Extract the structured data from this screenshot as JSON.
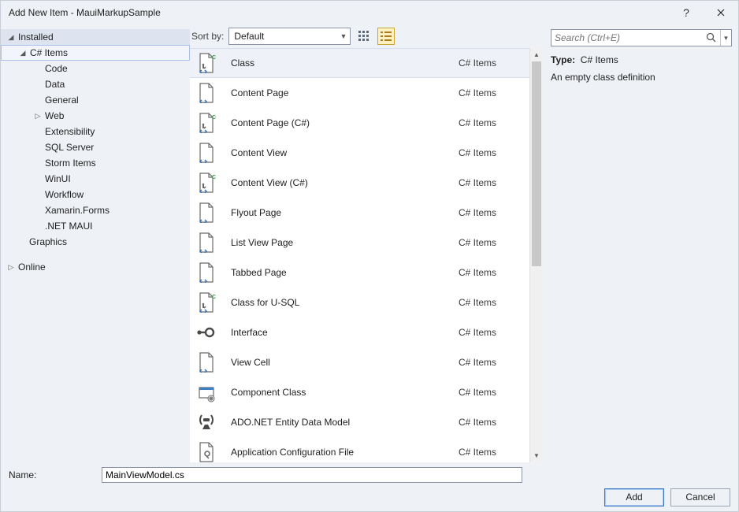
{
  "title": "Add New Item - MauiMarkupSample",
  "tree": {
    "root_installed": "Installed",
    "csharp_items": "C# Items",
    "csharp_children": [
      "Code",
      "Data",
      "General",
      "Web",
      "Extensibility",
      "SQL Server",
      "Storm Items",
      "WinUI",
      "Workflow",
      "Xamarin.Forms",
      ".NET MAUI"
    ],
    "graphics": "Graphics",
    "online": "Online"
  },
  "sort": {
    "label": "Sort by:",
    "value": "Default"
  },
  "templates": [
    {
      "name": "Class",
      "cat": "C# Items",
      "icon": "cs-file",
      "selected": true
    },
    {
      "name": "Content Page",
      "cat": "C# Items",
      "icon": "code-file"
    },
    {
      "name": "Content Page (C#)",
      "cat": "C# Items",
      "icon": "cs-file"
    },
    {
      "name": "Content View",
      "cat": "C# Items",
      "icon": "code-file"
    },
    {
      "name": "Content View (C#)",
      "cat": "C# Items",
      "icon": "cs-file"
    },
    {
      "name": "Flyout Page",
      "cat": "C# Items",
      "icon": "code-file"
    },
    {
      "name": "List View Page",
      "cat": "C# Items",
      "icon": "code-file"
    },
    {
      "name": "Tabbed Page",
      "cat": "C# Items",
      "icon": "code-file"
    },
    {
      "name": "Class for U-SQL",
      "cat": "C# Items",
      "icon": "cs-file"
    },
    {
      "name": "Interface",
      "cat": "C# Items",
      "icon": "interface"
    },
    {
      "name": "View Cell",
      "cat": "C# Items",
      "icon": "code-file"
    },
    {
      "name": "Component Class",
      "cat": "C# Items",
      "icon": "component"
    },
    {
      "name": "ADO.NET Entity Data Model",
      "cat": "C# Items",
      "icon": "entity"
    },
    {
      "name": "Application Configuration File",
      "cat": "C# Items",
      "icon": "config"
    }
  ],
  "search": {
    "placeholder": "Search (Ctrl+E)"
  },
  "details": {
    "type_label": "Type:",
    "type_value": "C# Items",
    "description": "An empty class definition"
  },
  "footer": {
    "name_label": "Name:",
    "name_value": "MainViewModel.cs",
    "add": "Add",
    "cancel": "Cancel"
  }
}
